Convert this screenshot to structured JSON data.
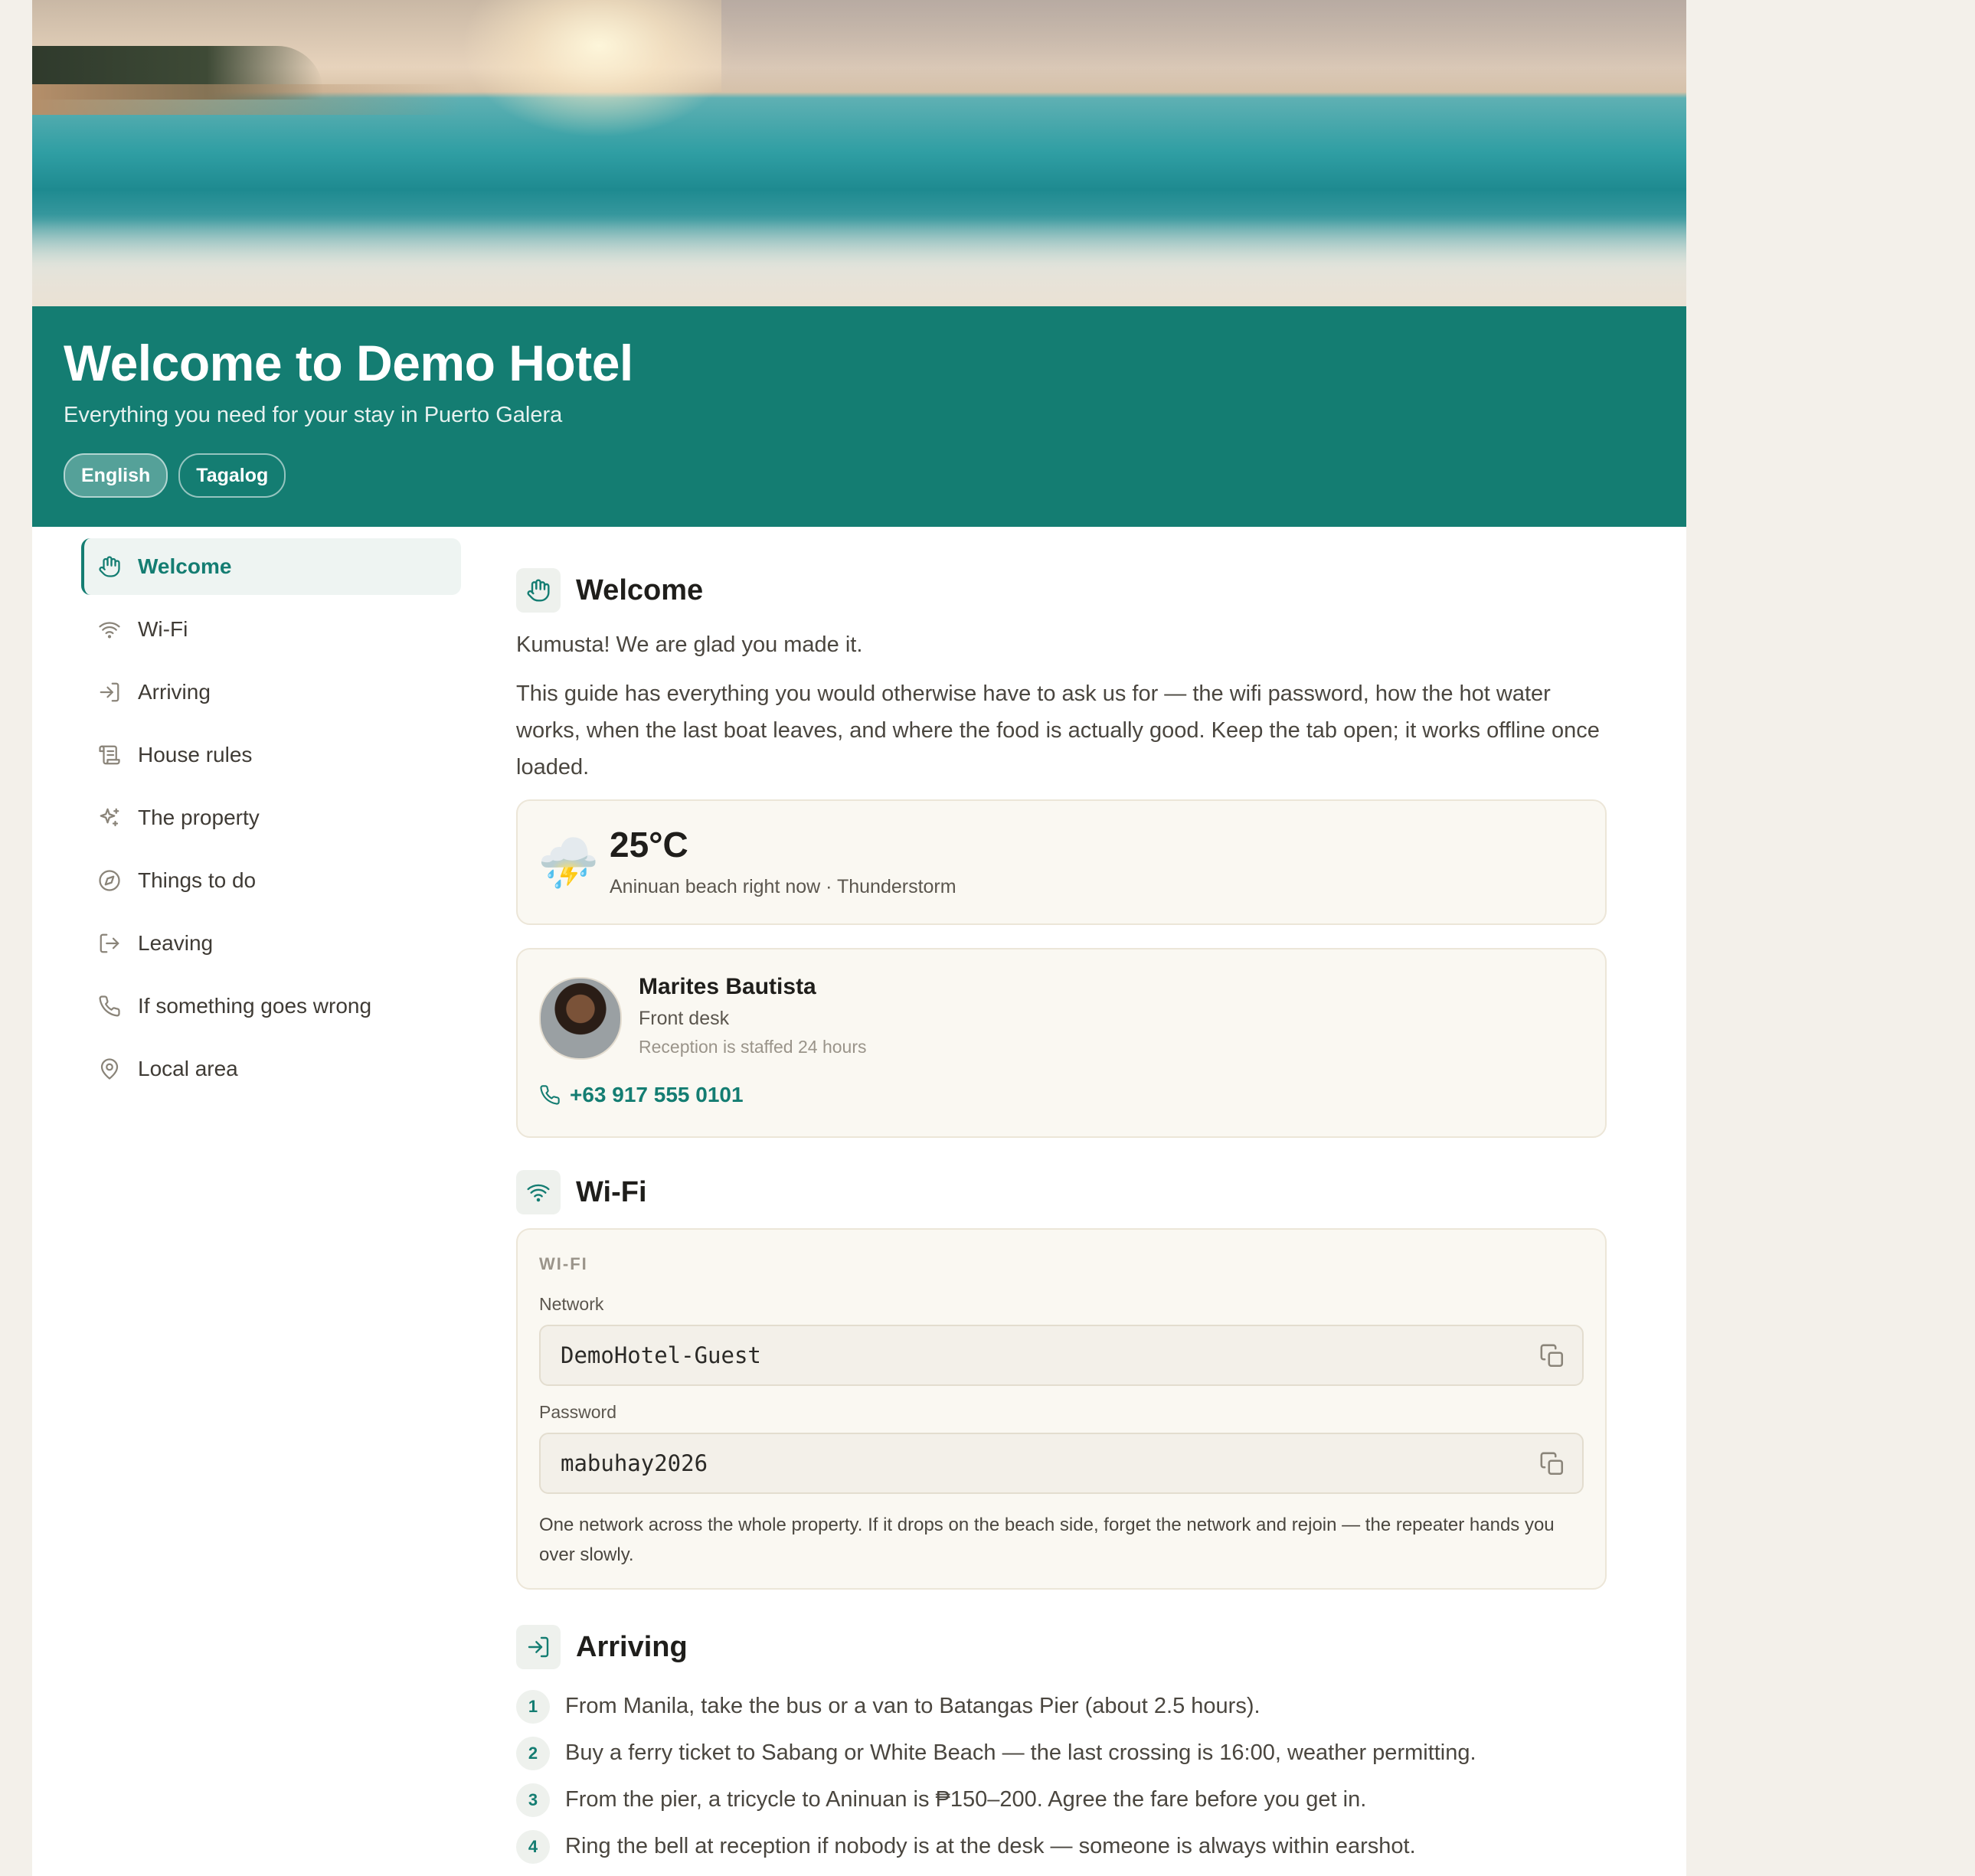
{
  "header": {
    "title": "Welcome to Demo Hotel",
    "subtitle": "Everything you need for your stay in Puerto Galera",
    "languages": [
      {
        "label": "English",
        "active": true
      },
      {
        "label": "Tagalog",
        "active": false
      }
    ]
  },
  "sidebar": {
    "items": [
      {
        "label": "Welcome",
        "icon": "hand-icon",
        "active": true
      },
      {
        "label": "Wi-Fi",
        "icon": "wifi-icon"
      },
      {
        "label": "Arriving",
        "icon": "login-icon"
      },
      {
        "label": "House rules",
        "icon": "scroll-icon"
      },
      {
        "label": "The property",
        "icon": "sparkles-icon"
      },
      {
        "label": "Things to do",
        "icon": "compass-icon"
      },
      {
        "label": "Leaving",
        "icon": "logout-icon"
      },
      {
        "label": "If something goes wrong",
        "icon": "phone-icon"
      },
      {
        "label": "Local area",
        "icon": "map-pin-icon"
      }
    ]
  },
  "welcome": {
    "title": "Welcome",
    "greeting": "Kumusta! We are glad you made it.",
    "intro": "This guide has everything you would otherwise have to ask us for — the wifi password, how the hot water works, when the last boat leaves, and where the food is actually good. Keep the tab open; it works offline once loaded.",
    "weather": {
      "emoji": "⛈️",
      "temperature": "25°C",
      "description": "Aninuan beach right now · Thunderstorm"
    },
    "contact": {
      "name": "Marites Bautista",
      "role": "Front desk",
      "note": "Reception is staffed 24 hours",
      "phone": "+63 917 555 0101"
    }
  },
  "wifi": {
    "title": "Wi-Fi",
    "kicker": "WI-FI",
    "network_label": "Network",
    "network_value": "DemoHotel-Guest",
    "password_label": "Password",
    "password_value": "mabuhay2026",
    "help": "One network across the whole property. If it drops on the beach side, forget the network and rejoin — the repeater hands you over slowly."
  },
  "arriving": {
    "title": "Arriving",
    "steps": [
      {
        "num": "1",
        "text": "From Manila, take the bus or a van to Batangas Pier (about 2.5 hours)."
      },
      {
        "num": "2",
        "text": "Buy a ferry ticket to Sabang or White Beach — the last crossing is 16:00, weather permitting."
      },
      {
        "num": "3",
        "text": "From the pier, a tricycle to Aninuan is ₱150–200. Agree the fare before you get in."
      },
      {
        "num": "4",
        "text": "Ring the bell at reception if nobody is at the desk — someone is always within earshot."
      }
    ]
  },
  "colors": {
    "accent": "#147d72",
    "background": "#f3f0ea",
    "card": "#faf8f2"
  }
}
